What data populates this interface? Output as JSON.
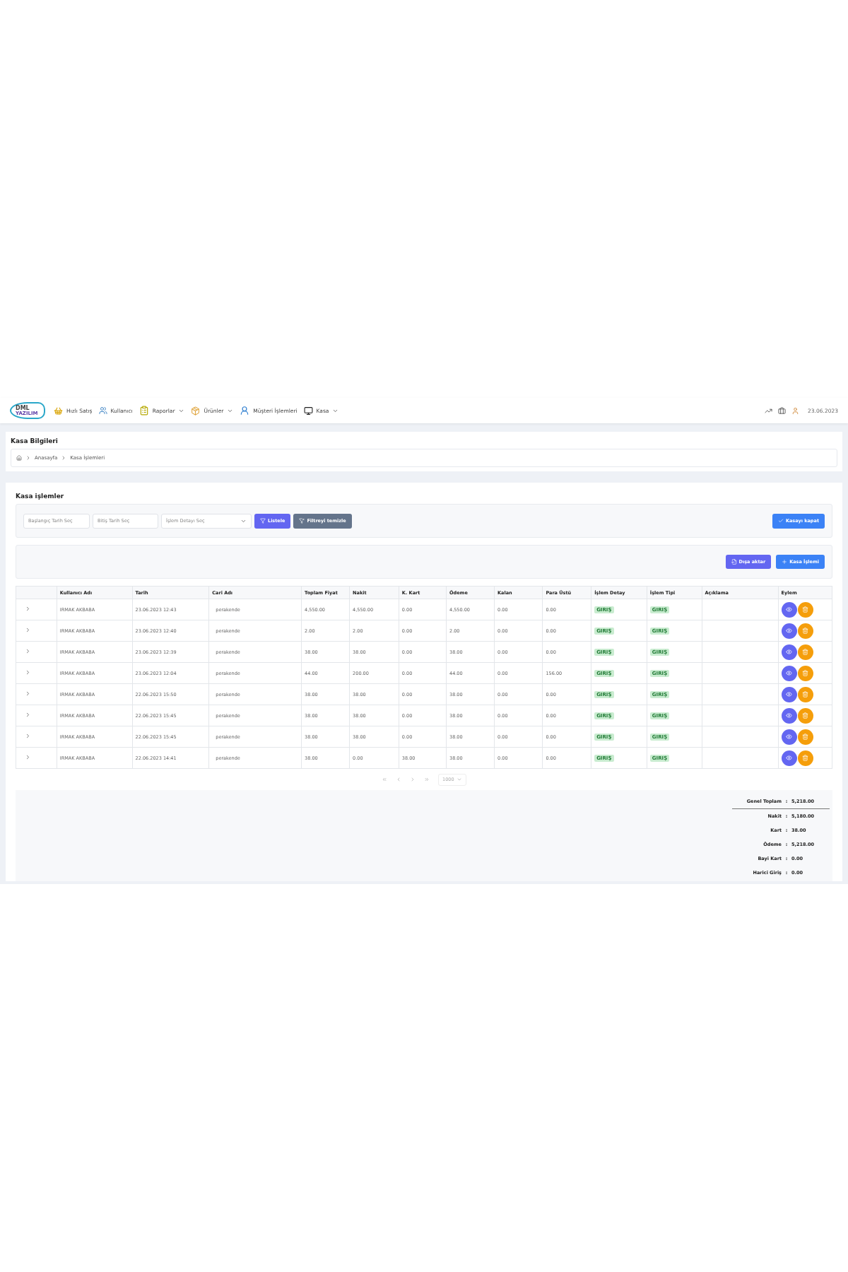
{
  "nav": {
    "logo": {
      "line_1": "DML",
      "line_2": "YAZILIM"
    },
    "items": [
      {
        "kind": "basket",
        "label": "Hızlı Satış",
        "dropdown": false
      },
      {
        "kind": "users",
        "label": "Kullanıcı",
        "dropdown": false
      },
      {
        "kind": "clipboard",
        "label": "Raporlar",
        "dropdown": true
      },
      {
        "kind": "box",
        "label": "Ürünler",
        "dropdown": true
      },
      {
        "kind": "customer",
        "label": "Müşteri İşlemleri",
        "dropdown": false
      },
      {
        "kind": "register",
        "label": "Kasa",
        "dropdown": true
      }
    ],
    "date": "23.06.2023"
  },
  "header": {
    "title": "Kasa Bilgileri",
    "breadcrumb": [
      "Anasayfa",
      "Kasa İşlemleri"
    ]
  },
  "panel": {
    "title": "Kasa işlemler",
    "filters": {
      "start_placeholder": "Başlangıç Tarih Seç",
      "end_placeholder": "Bitiş Tarih Seç",
      "detail_placeholder": "İşlem Detayı Seç",
      "list_button": "Listele",
      "clear_button": "Filtreyi temizle",
      "close_button": "Kasayı kapat"
    },
    "actions": {
      "export_button": "Dışa aktar",
      "add_button": "Kasa İşlemi"
    },
    "table": {
      "columns": [
        "Kullanıcı Adı",
        "Tarih",
        "Cari Adı",
        "Toplam Fiyat",
        "Nakit",
        "K. Kart",
        "Ödeme",
        "Kalan",
        "Para Üstü",
        "İşlem Detay",
        "İşlem Tipi",
        "Açıklama",
        "Eylem"
      ],
      "rows": [
        {
          "user": "IRMAK AKBABA",
          "date": "23.06.2023 12:43",
          "account": "perakende",
          "total": "4,550.00",
          "cash": "4,550.00",
          "card": "0.00",
          "payment": "4,550.00",
          "remaining": "0.00",
          "change": "0.00",
          "detail": "GIRIŞ",
          "type": "GIRIŞ"
        },
        {
          "user": "IRMAK AKBABA",
          "date": "23.06.2023 12:40",
          "account": "perakende",
          "total": "2.00",
          "cash": "2.00",
          "card": "0.00",
          "payment": "2.00",
          "remaining": "0.00",
          "change": "0.00",
          "detail": "GIRIŞ",
          "type": "GIRIŞ"
        },
        {
          "user": "IRMAK AKBABA",
          "date": "23.06.2023 12:39",
          "account": "perakende",
          "total": "38.00",
          "cash": "38.00",
          "card": "0.00",
          "payment": "38.00",
          "remaining": "0.00",
          "change": "0.00",
          "detail": "GIRIŞ",
          "type": "GIRIŞ"
        },
        {
          "user": "IRMAK AKBABA",
          "date": "23.06.2023 12:04",
          "account": "perakende",
          "total": "44.00",
          "cash": "200.00",
          "card": "0.00",
          "payment": "44.00",
          "remaining": "0.00",
          "change": "156.00",
          "detail": "GIRIŞ",
          "type": "GIRIŞ"
        },
        {
          "user": "IRMAK AKBABA",
          "date": "22.06.2023 15:50",
          "account": "perakende",
          "total": "38.00",
          "cash": "38.00",
          "card": "0.00",
          "payment": "38.00",
          "remaining": "0.00",
          "change": "0.00",
          "detail": "GIRIŞ",
          "type": "GIRIŞ"
        },
        {
          "user": "IRMAK AKBABA",
          "date": "22.06.2023 15:45",
          "account": "perakende",
          "total": "38.00",
          "cash": "38.00",
          "card": "0.00",
          "payment": "38.00",
          "remaining": "0.00",
          "change": "0.00",
          "detail": "GIRIŞ",
          "type": "GIRIŞ"
        },
        {
          "user": "IRMAK AKBABA",
          "date": "22.06.2023 15:45",
          "account": "perakende",
          "total": "38.00",
          "cash": "38.00",
          "card": "0.00",
          "payment": "38.00",
          "remaining": "0.00",
          "change": "0.00",
          "detail": "GIRIŞ",
          "type": "GIRIŞ"
        },
        {
          "user": "IRMAK AKBABA",
          "date": "22.06.2023 14:41",
          "account": "perakende",
          "total": "38.00",
          "cash": "0.00",
          "card": "38.00",
          "payment": "38.00",
          "remaining": "0.00",
          "change": "0.00",
          "detail": "GIRIŞ",
          "type": "GIRIŞ"
        }
      ]
    },
    "pagination": {
      "page_size": "1000"
    },
    "summary": [
      {
        "label": "Genel Toplam",
        "colon": ":",
        "value": "5,218.00",
        "separator": true
      },
      {
        "label": "Nakit",
        "colon": ":",
        "value": "5,180.00",
        "separator": false
      },
      {
        "label": "Kart",
        "colon": ":",
        "value": "38.00",
        "separator": false
      },
      {
        "label": "Ödeme",
        "colon": ":",
        "value": "5,218.00",
        "separator": false
      },
      {
        "label": "Bayi Kart",
        "colon": ":",
        "value": "0.00",
        "separator": false
      },
      {
        "label": "Harici Giriş",
        "colon": ":",
        "value": "0.00",
        "separator": false
      }
    ]
  }
}
